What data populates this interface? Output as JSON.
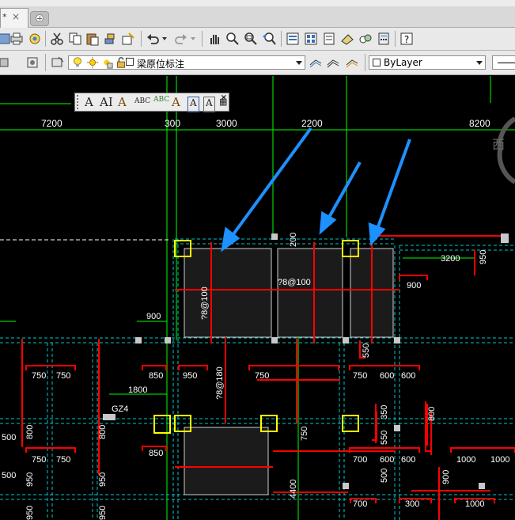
{
  "app": {
    "active_tab": "*",
    "tab_close": "×"
  },
  "toolbar1": {
    "icons": [
      "new-drawing-icon",
      "print-icon",
      "plot-preview-icon",
      "publish-icon",
      "cut-icon",
      "copy-icon",
      "paste-icon",
      "match-properties-icon",
      "block-editor-icon",
      "undo-icon",
      "redo-icon",
      "pan-icon",
      "zoom-realtime-icon",
      "zoom-window-icon",
      "zoom-previous-icon",
      "properties-icon",
      "design-center-icon",
      "tool-palettes-icon",
      "sheet-set-icon",
      "markup-icon",
      "calculator-icon",
      "help-icon"
    ]
  },
  "toolbar2": {
    "layer_combo_value": "梁原位标注",
    "bylayer_value": "ByLayer"
  },
  "text_palette": {
    "icons": [
      "multiline-text-icon",
      "single-line-text-icon",
      "edit-text-icon",
      "find-replace-icon",
      "spell-check-icon",
      "text-style-icon",
      "scale-text-icon",
      "justify-text-icon",
      "convert-to-mtext-icon"
    ],
    "close": "×"
  },
  "drawing": {
    "top_dimensions": [
      "7200",
      "300",
      "3000",
      "2200",
      "8200"
    ],
    "compass_label": "西",
    "labels": {
      "d200": "200",
      "d3200": "3200",
      "d950a": "950",
      "d900a": "900",
      "slab1": "?8@100",
      "slab2": "?8@100",
      "d900b": "900",
      "d550": "550",
      "d750_1": "750",
      "d750_2": "750",
      "d850_1": "850",
      "d950_2": "950",
      "d750_3": "750",
      "d750_4": "750",
      "d600_1": "600",
      "d600_2": "600",
      "slab3": "?8@180",
      "d1800": "1800",
      "gz4": "GZ4",
      "d800_1": "800",
      "d800_2": "800",
      "d850_2": "850",
      "d550_2": "550",
      "d350": "350",
      "d800_3": "800",
      "d750_5": "750",
      "d500_1": "500",
      "d750_6": "750",
      "d750_7": "750",
      "d500_2": "500",
      "d700_1": "700",
      "d600_3": "600",
      "d600_4": "600",
      "d1000_1": "1000",
      "d1000_2": "1000",
      "d950_3": "950",
      "d950_4": "950",
      "d500_3": "500",
      "d900_c": "900",
      "d700_2": "700",
      "d300": "300",
      "d1000_3": "1000",
      "d4400": "4400",
      "d950_5": "950",
      "d950_6": "950"
    }
  },
  "colors": {
    "beam_red": "#ff0000",
    "axis_green": "#00ff00",
    "arrow_blue": "#1e90ff",
    "column_yellow": "#ffff00",
    "grid_cyan": "#00c8c8"
  }
}
